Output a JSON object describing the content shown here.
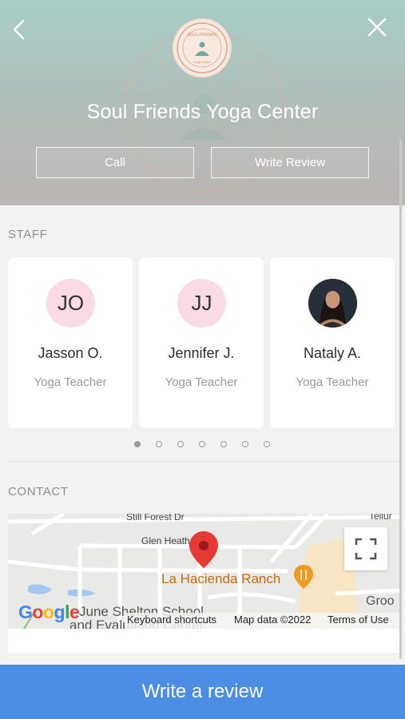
{
  "header": {
    "title": "Soul Friends Yoga Center",
    "call_label": "Call",
    "write_review_label": "Write Review",
    "logo_text_top": "SOUL FRIENDS",
    "logo_text_bottom": "Yoga Center"
  },
  "staff": {
    "section_label": "STAFF",
    "members": [
      {
        "initials": "JO",
        "name": "Jasson O.",
        "role": "Yoga Teacher",
        "photo": false
      },
      {
        "initials": "JJ",
        "name": "Jennifer J.",
        "role": "Yoga Teacher",
        "photo": false
      },
      {
        "initials": "",
        "name": "Nataly A.",
        "role": "Yoga Teacher",
        "photo": true
      }
    ],
    "pages": 7,
    "active_page": 1
  },
  "contact": {
    "section_label": "CONTACT",
    "map": {
      "streets": [
        "Still Forest Dr",
        "Glen Heath",
        "Tellur",
        "Groo"
      ],
      "poi": "La Hacienda Ranch",
      "school": "June Shelton School",
      "school_line2": "and Evaluation Center",
      "google": "Google",
      "keyboard_shortcuts": "Keyboard shortcuts",
      "map_data": "Map data ©2022",
      "terms": "Terms of Use"
    }
  },
  "cta": {
    "label": "Write a review"
  },
  "colors": {
    "cta": "#4b8ee3",
    "avatar_bg": "#fadbe5",
    "pin": "#e53935",
    "poi": "#c8690b"
  }
}
